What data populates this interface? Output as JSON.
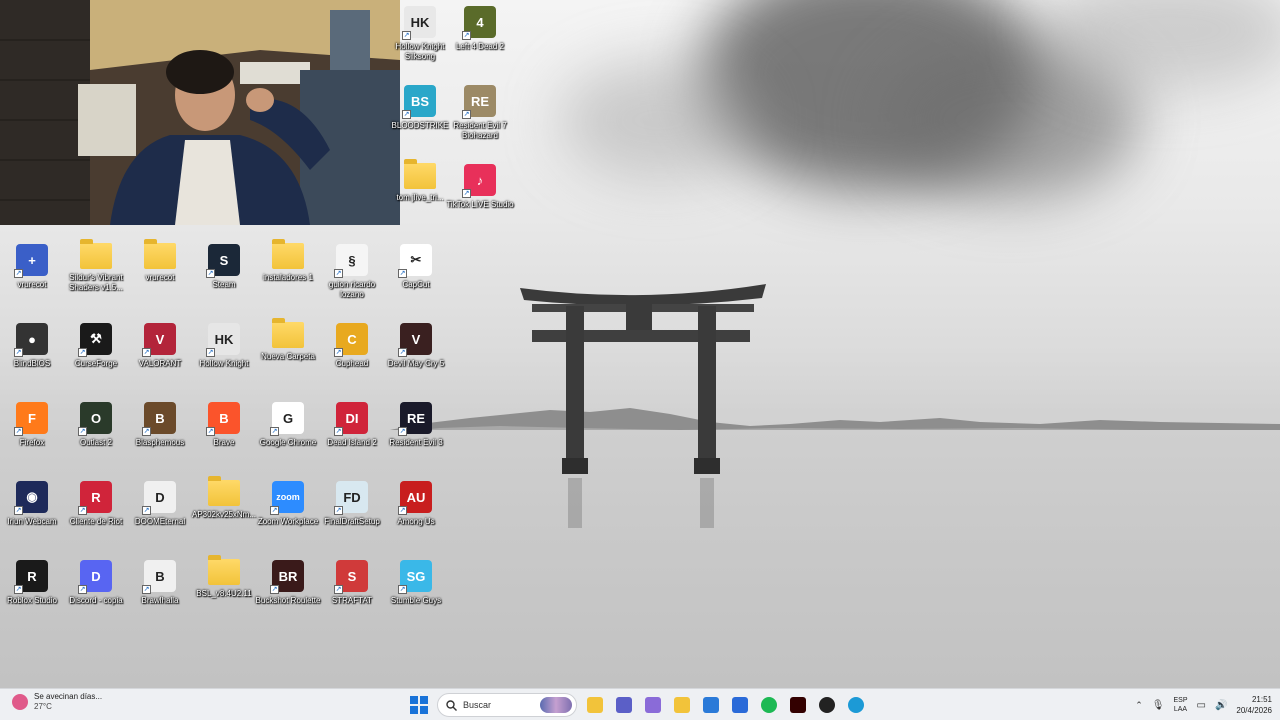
{
  "desktop": {
    "icons": [
      {
        "label": "Hollow Knight Silksong",
        "kind": "app",
        "color": "#e8e8e8",
        "glyph": "HK"
      },
      {
        "label": "Left 4 Dead 2",
        "kind": "app",
        "color": "#5a6b2a",
        "glyph": "4"
      },
      {
        "label": "BLOODSTRIKE",
        "kind": "app",
        "color": "#2aa7c9",
        "glyph": "BS"
      },
      {
        "label": "Resident Evil 7 Biohazard",
        "kind": "app",
        "color": "#9c8a66",
        "glyph": "RE"
      },
      {
        "label": "tom jlive_tri...",
        "kind": "folder"
      },
      {
        "label": "TikTok LIVE Studio",
        "kind": "app",
        "color": "#e8305a",
        "glyph": "♪"
      },
      {
        "label": "vrurecot",
        "kind": "app",
        "color": "#3a5fc8",
        "glyph": "+"
      },
      {
        "label": "Sildur's Vibrant Shaders v1.5...",
        "kind": "folder"
      },
      {
        "label": "vrurecot",
        "kind": "folder"
      },
      {
        "label": "Steam",
        "kind": "app",
        "color": "#1b2838",
        "glyph": "S"
      },
      {
        "label": "instaladores 1",
        "kind": "folder"
      },
      {
        "label": "guion ricardo lozano",
        "kind": "app",
        "color": "#f5f5f5",
        "glyph": "§"
      },
      {
        "label": "CapCut",
        "kind": "app",
        "color": "#ffffff",
        "glyph": "✂"
      },
      {
        "label": "BlindBlOS",
        "kind": "app",
        "color": "#333333",
        "glyph": "●"
      },
      {
        "label": "CurseForge",
        "kind": "app",
        "color": "#1a1a1a",
        "glyph": "⚒"
      },
      {
        "label": "VALORANT",
        "kind": "app",
        "color": "#b3243a",
        "glyph": "V"
      },
      {
        "label": "Hollow Knight",
        "kind": "app",
        "color": "#e6e6e6",
        "glyph": "HK"
      },
      {
        "label": "Nueva Carpeta",
        "kind": "folder"
      },
      {
        "label": "Cuphead",
        "kind": "app",
        "color": "#e8a91f",
        "glyph": "C"
      },
      {
        "label": "Devil May Cry 5",
        "kind": "app",
        "color": "#3a2020",
        "glyph": "V"
      },
      {
        "label": "Firefox",
        "kind": "app",
        "color": "#ff7a1a",
        "glyph": "F"
      },
      {
        "label": "Outlast 2",
        "kind": "app",
        "color": "#2a3a2a",
        "glyph": "O"
      },
      {
        "label": "Blasphemous",
        "kind": "app",
        "color": "#6b4a2a",
        "glyph": "B"
      },
      {
        "label": "Brave",
        "kind": "app",
        "color": "#fb542b",
        "glyph": "B"
      },
      {
        "label": "Google Chrome",
        "kind": "app",
        "color": "#ffffff",
        "glyph": "G"
      },
      {
        "label": "Dead Island 2",
        "kind": "app",
        "color": "#d0243a",
        "glyph": "DI"
      },
      {
        "label": "Resident Evil 3",
        "kind": "app",
        "color": "#1a1a2a",
        "glyph": "RE"
      },
      {
        "label": "Iriun Webcam",
        "kind": "app",
        "color": "#1e2a5a",
        "glyph": "◉"
      },
      {
        "label": "Cliente de Riot",
        "kind": "app",
        "color": "#d0243a",
        "glyph": "R"
      },
      {
        "label": "DOOMEternal",
        "kind": "app",
        "color": "#f0f0f0",
        "glyph": "D"
      },
      {
        "label": "AP302kv25xNm...",
        "kind": "folder"
      },
      {
        "label": "Zoom Workplace",
        "kind": "app",
        "color": "#2d8cff",
        "glyph": "zoom"
      },
      {
        "label": "FinalDraftSetup",
        "kind": "app",
        "color": "#d8e8f0",
        "glyph": "FD"
      },
      {
        "label": "Among Us",
        "kind": "app",
        "color": "#c81e1e",
        "glyph": "AU"
      },
      {
        "label": "Roblox Studio",
        "kind": "app",
        "color": "#1a1a1a",
        "glyph": "R"
      },
      {
        "label": "Discord - copia",
        "kind": "app",
        "color": "#5865f2",
        "glyph": "D"
      },
      {
        "label": "Brawlhalla",
        "kind": "app",
        "color": "#f0f0f0",
        "glyph": "B"
      },
      {
        "label": "BSL_v8.4U2.11",
        "kind": "folder"
      },
      {
        "label": "Buckshot Roulette",
        "kind": "app",
        "color": "#3a1a1a",
        "glyph": "BR"
      },
      {
        "label": "STRAFTAT",
        "kind": "app",
        "color": "#d03a3a",
        "glyph": "S"
      },
      {
        "label": "Stumble Guys",
        "kind": "app",
        "color": "#3ab8e8",
        "glyph": "SG"
      }
    ]
  },
  "taskbar": {
    "weather_title": "Se avecinan días...",
    "weather_temp": "27°C",
    "search_label": "Buscar",
    "apps": [
      {
        "name": "file-explorer",
        "color": "#f2c33a"
      },
      {
        "name": "teams",
        "color": "#5b5fc7"
      },
      {
        "name": "copilot",
        "color": "#8a6bd8"
      },
      {
        "name": "files",
        "color": "#f2c33a"
      },
      {
        "name": "store",
        "color": "#2a7ad8"
      },
      {
        "name": "phone-link",
        "color": "#2a6ad8"
      },
      {
        "name": "spotify",
        "color": "#1db954"
      },
      {
        "name": "adobe-illustrator",
        "color": "#330000"
      },
      {
        "name": "obs",
        "color": "#222222"
      },
      {
        "name": "edge",
        "color": "#1c9ad6"
      }
    ],
    "lang_top": "ESP",
    "lang_bottom": "LAA",
    "time": "21:51",
    "date": "20/4/2026"
  }
}
